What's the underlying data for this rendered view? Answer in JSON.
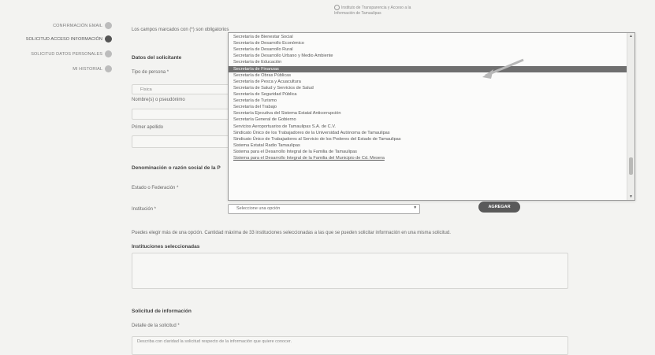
{
  "top_note": "Instituto de Transparencia y Acceso a la Información de Tamaulipas",
  "sidebar": {
    "items": [
      {
        "label": "Confirmación Email",
        "active": false
      },
      {
        "label": "Solicitud acceso información",
        "active": true
      },
      {
        "label": "Solicitud datos personales",
        "active": false
      },
      {
        "label": "Mi historial",
        "active": false
      }
    ]
  },
  "form": {
    "required_note": "Los campos marcados con (*) son obligatorios",
    "solicitante_heading": "Datos del solicitante",
    "tipo_persona_label": "Tipo de persona *",
    "tipo_persona_value": "Física",
    "nombre_label": "Nombre(s) o pseudónimo",
    "primer_apellido_label": "Primer apellido",
    "razon_social_label": "Denominación o razón social de la P",
    "estado_label": "Estado o Federación *",
    "institucion_label": "Institución *",
    "institucion_select_value": "Seleccione una opción",
    "agregar_button": "AGREGAR",
    "help_text": "Puedes elegir más de una opción. Cantidad máxima de 33 instituciones seleccionadas a las que se pueden solicitar información en una misma solicitud.",
    "instituciones_heading": "Instituciones seleccionadas",
    "solicitud_heading": "Solicitud de información",
    "detalle_label": "Detalle de la solicitud *",
    "detalle_placeholder": "Describa con claridad la solicitud respecto de la información que quiere conocer."
  },
  "listbox": {
    "selected_index": 5,
    "options": [
      "Secretaría de Bienestar Social",
      "Secretaría de Desarrollo Económico",
      "Secretaría de Desarrollo Rural",
      "Secretaría de Desarrollo Urbano y Medio Ambiente",
      "Secretaría de Educación",
      "Secretaría de Finanzas",
      "Secretaría de Obras Públicas",
      "Secretaría de Pesca y Acuacultura",
      "Secretaría de Salud y Servicios de Salud",
      "Secretaría de Seguridad Pública",
      "Secretaría de Turismo",
      "Secretaría del Trabajo",
      "Secretaría Ejecutiva del Sistema Estatal Anticorrupción",
      "Secretaría General de Gobierno",
      "Servicios Aeroportuarios de Tamaulipas S.A. de C.V.",
      "Sindicato Único de los Trabajadores de la Universidad Autónoma de Tamaulipas",
      "Sindicato Único de Trabajadores al Servicio de los Poderes del Estado de Tamaulipas",
      "Sistema Estatal Radio Tamaulipas",
      "Sistema para el Desarrollo Integral de la Familia de Tamaulipas",
      "Sistema para el Desarrollo Integral de la Familia del Municipio de Cd. Mesera"
    ]
  },
  "colors": {
    "page_bg": "#f3f3f1",
    "selected_row_bg": "#6f6f6f",
    "button_bg": "#5a5a5a"
  }
}
